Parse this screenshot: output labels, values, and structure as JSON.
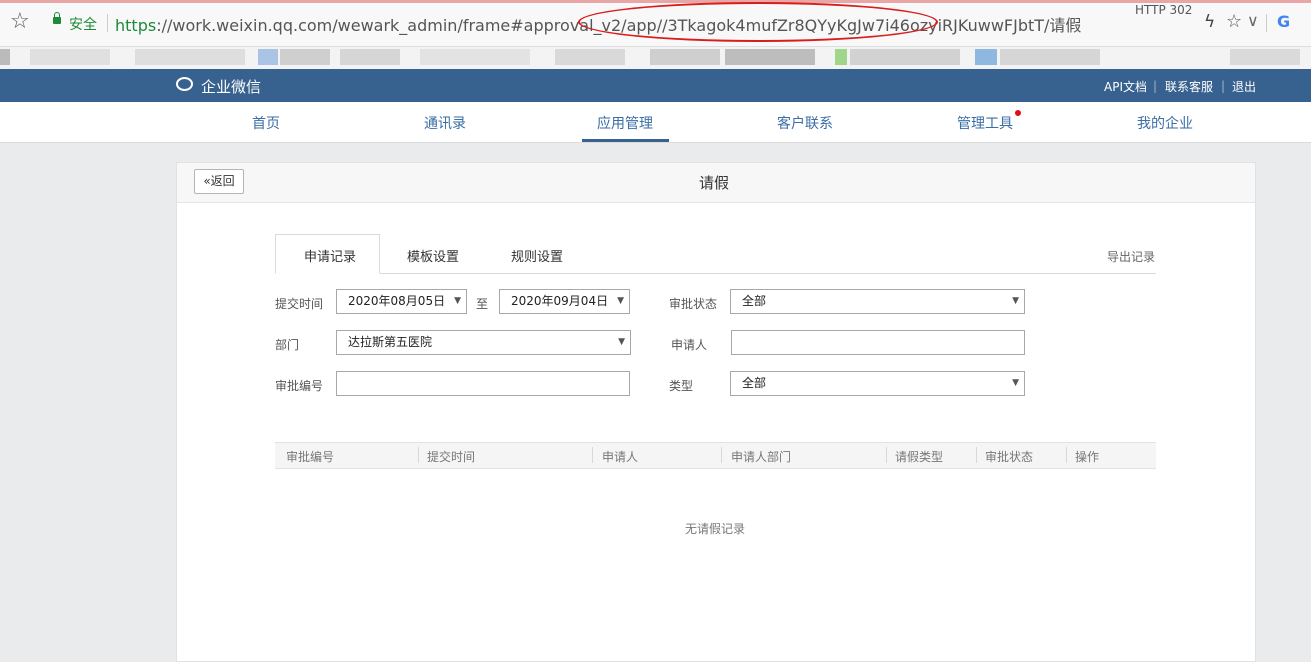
{
  "browser": {
    "secure_label": "安全",
    "url_https": "https",
    "url_rest": "://work.weixin.qq.com/wewark_admin/frame#approval_v2/app/",
    "url_highlight": "/3Tkagok4mufZr8QYyKgJw7i46ozyiRJKuwwFJbtT/请假",
    "bookmark_text": "HTTP 302",
    "circle_color": "#d91c1c"
  },
  "header": {
    "brand": "企业微信",
    "links": [
      "API文档",
      "联系客服",
      "退出"
    ],
    "color": "#37618f"
  },
  "nav": {
    "items": [
      "首页",
      "通讯录",
      "应用管理",
      "客户联系",
      "管理工具",
      "我的企业"
    ],
    "active": "应用管理"
  },
  "panel": {
    "back_label": "返回",
    "title": "请假"
  },
  "tabs": {
    "items": [
      "申请记录",
      "模板设置",
      "规则设置"
    ],
    "active": "申请记录",
    "export_label": "导出记录"
  },
  "filters": {
    "submit_time_label": "提交时间",
    "date_from": "2020年08月05日",
    "to_label": "至",
    "date_to": "2020年09月04日",
    "status_label": "审批状态",
    "status_value": "全部",
    "dept_label": "部门",
    "dept_value": "达拉斯第五医院",
    "applicant_label": "申请人",
    "applicant_value": "",
    "number_label": "审批编号",
    "number_value": "",
    "type_label": "类型",
    "type_value": "全部"
  },
  "table": {
    "columns": [
      "审批编号",
      "提交时间",
      "申请人",
      "申请人部门",
      "请假类型",
      "审批状态",
      "操作"
    ],
    "empty_text": "无请假记录"
  }
}
